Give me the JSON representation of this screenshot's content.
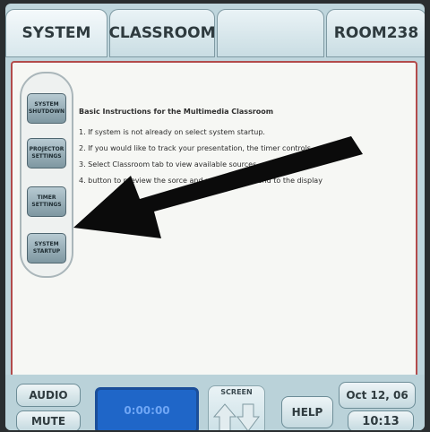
{
  "tabs": {
    "system": "SYSTEM",
    "classroom": "CLASSROOM",
    "blank": "",
    "room": "ROOM238"
  },
  "sidebar": {
    "buttons": [
      "SYSTEM SHUTDOWN",
      "PROJECTOR SETTINGS",
      "TIMER SETTINGS",
      "SYSTEM STARTUP"
    ]
  },
  "instructions": {
    "title": "Basic Instructions for the Multimedia Classroom",
    "items": [
      "1. If system is not already on select system startup.",
      "2. If you would like to track your presentation,                              the timer controls.",
      "3. Select Classroom                               tab to view available sources.",
      "4.                                    button to preview the sorce and use action to send to the display"
    ]
  },
  "bottom": {
    "audio": "AUDIO",
    "mute": "MUTE",
    "timer": "0:00:00",
    "screen": "SCREEN",
    "help": "HELP",
    "date": "Oct 12, 06",
    "time": "10:13"
  },
  "colors": {
    "panel_border": "#b24b4b",
    "timer_bg": "#1f66c8",
    "tab_bg": "#eaf3f6"
  }
}
